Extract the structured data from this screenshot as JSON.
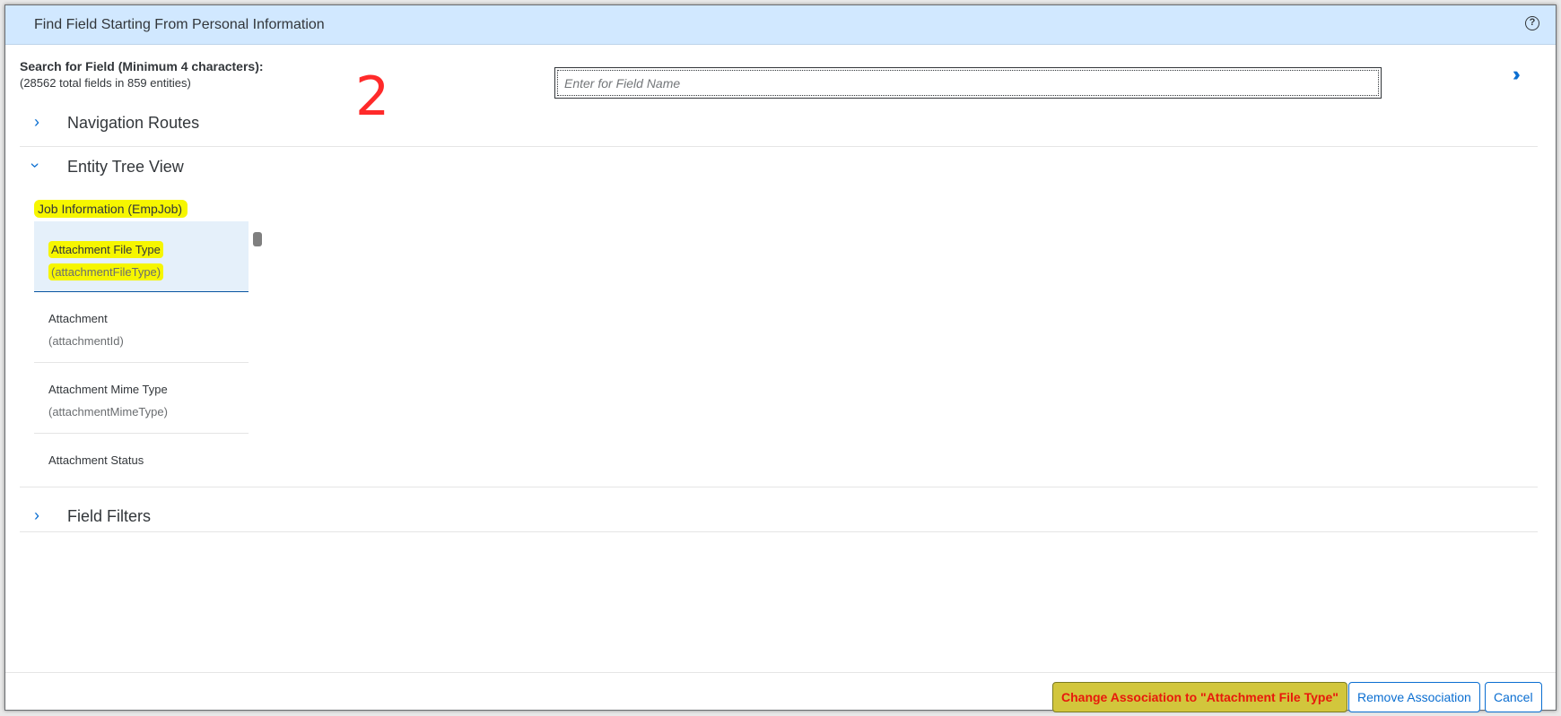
{
  "dialog": {
    "title": "Find Field Starting From Personal Information",
    "help_icon": "help-icon"
  },
  "search": {
    "label": "Search for Field (Minimum 4 characters):",
    "subtext": "(28562 total fields in 859 entities)",
    "placeholder": "Enter for Field Name",
    "value": ""
  },
  "annotation": {
    "text": "2",
    "color": "#ff2a2a"
  },
  "sections": {
    "navigation_routes": "Navigation Routes",
    "entity_tree_view": "Entity Tree View",
    "field_filters": "Field Filters"
  },
  "entity_tree": {
    "entity_label": "Job Information (EmpJob)",
    "items": [
      {
        "name": "Attachment File Type",
        "code": "(attachmentFileType)",
        "selected": true
      },
      {
        "name": "Attachment",
        "code": "(attachmentId)",
        "selected": false
      },
      {
        "name": "Attachment Mime Type",
        "code": "(attachmentMimeType)",
        "selected": false
      },
      {
        "name": "Attachment Status",
        "code": "",
        "selected": false
      }
    ]
  },
  "footer": {
    "primary_button": "Change Association to \"Attachment File Type\"",
    "remove_button": "Remove Association",
    "cancel_button": "Cancel"
  },
  "colors": {
    "header_bg": "#d1e8ff",
    "accent": "#0a6ed1",
    "highlight": "#f6f600",
    "primary_button_bg": "#d2c63c",
    "primary_button_text": "#e8190c"
  }
}
